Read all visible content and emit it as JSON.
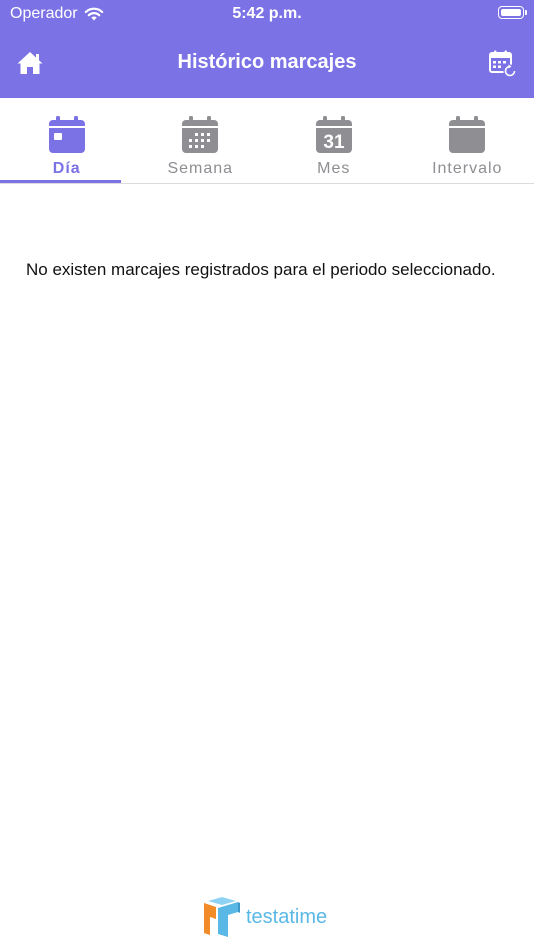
{
  "status_bar": {
    "carrier": "Operador",
    "time": "5:42 p.m."
  },
  "header": {
    "title": "Histórico marcajes"
  },
  "tabs": [
    {
      "label": "Día",
      "icon": "calendar-day-icon",
      "active": true
    },
    {
      "label": "Semana",
      "icon": "calendar-week-icon",
      "active": false
    },
    {
      "label": "Mes",
      "icon": "calendar-month-icon",
      "active": false,
      "icon_text": "31"
    },
    {
      "label": "Intervalo",
      "icon": "calendar-interval-icon",
      "active": false
    }
  ],
  "main": {
    "empty_message": "No existen marcajes registrados para el periodo seleccionado."
  },
  "footer": {
    "brand_name": "testatime"
  },
  "colors": {
    "accent": "#7b72e5",
    "inactive": "#8e8e93",
    "brand_cyan": "#5ab8e6",
    "brand_orange": "#f28c28"
  }
}
